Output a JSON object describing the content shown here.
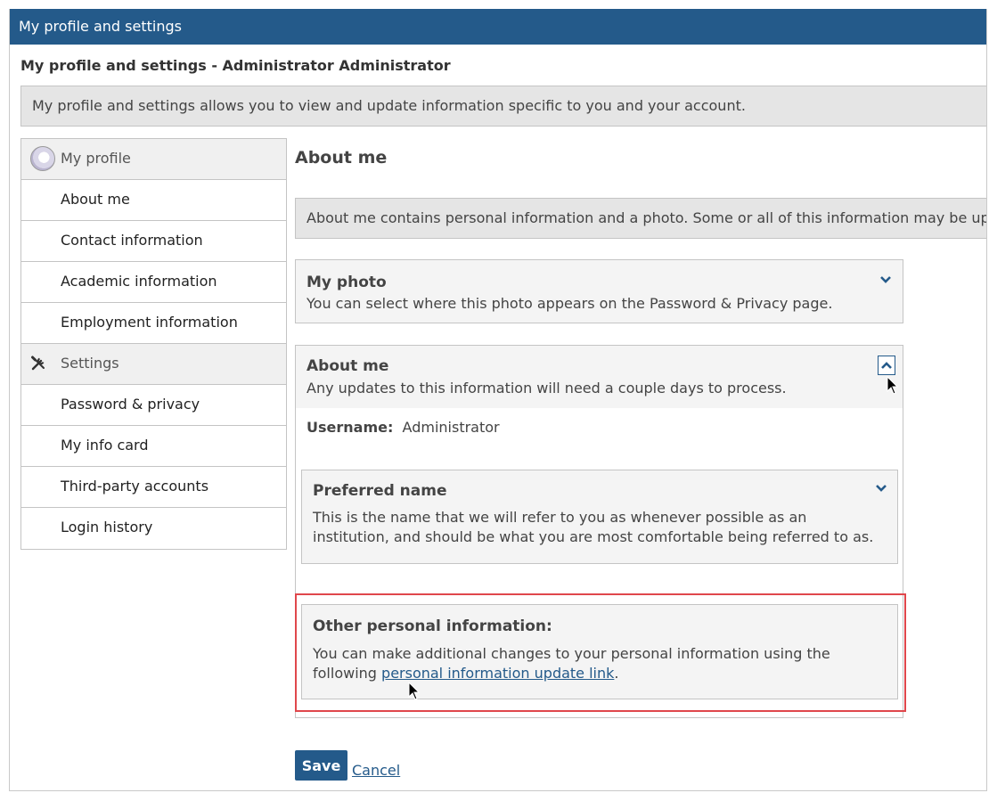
{
  "window": {
    "title": "My profile and settings"
  },
  "page": {
    "heading": "My profile and settings - Administrator Administrator",
    "intro": "My profile and settings allows you to view and update information specific to you and your account."
  },
  "sidebar": {
    "profile_header": "My profile",
    "profile_items": [
      "About me",
      "Contact information",
      "Academic information",
      "Employment information"
    ],
    "settings_header": "Settings",
    "settings_items": [
      "Password & privacy",
      "My info card",
      "Third-party accounts",
      "Login history"
    ]
  },
  "main": {
    "title": "About me",
    "description": "About me contains personal information and a photo. Some or all of this information may be updated.",
    "my_photo": {
      "title": "My photo",
      "subtitle": "You can select where this photo appears on the Password & Privacy page."
    },
    "about_me": {
      "title": "About me",
      "subtitle": "Any updates to this information will need a couple days to process.",
      "username_label": "Username:",
      "username_value": "Administrator"
    },
    "preferred_name": {
      "title": "Preferred name",
      "subtitle": "This is the name that we will refer to you as whenever possible as an institution, and should be what you are most comfortable being referred to as."
    },
    "other_info": {
      "title": "Other personal information:",
      "text": "You can make additional changes to your personal information using the following",
      "link": "personal information update link",
      "trail": "."
    }
  },
  "actions": {
    "save": "Save",
    "cancel": "Cancel"
  },
  "colors": {
    "brand": "#245a8a",
    "highlight": "#e0474c",
    "panel": "#f4f4f4"
  }
}
